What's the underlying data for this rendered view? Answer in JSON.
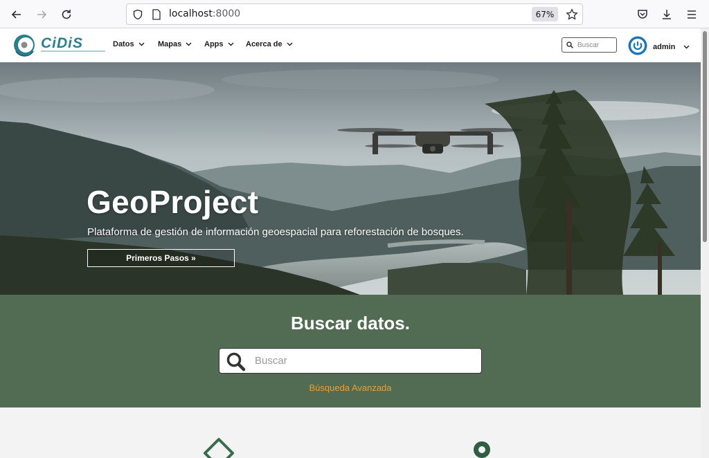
{
  "browser": {
    "url_host": "localhost",
    "url_port": ":8000",
    "zoom": "67%"
  },
  "site": {
    "logo_text": "CiDiS",
    "menu": [
      {
        "label": "Datos"
      },
      {
        "label": "Mapas"
      },
      {
        "label": "Apps"
      },
      {
        "label": "Acerca de"
      }
    ],
    "search_placeholder": "Buscar",
    "user": "admin"
  },
  "hero": {
    "title": "GeoProject",
    "subtitle": "Plataforma de gestión de información geoespacial para reforestación de bosques.",
    "button": "Primeros Pasos »"
  },
  "search_band": {
    "title": "Buscar datos.",
    "placeholder": "Buscar",
    "advanced_link": "Búsqueda Avanzada"
  },
  "colors": {
    "band_bg": "#526b53",
    "link_orange": "#e8a138",
    "logo_teal": "#2a7e8e",
    "user_blue": "#1e77b5"
  }
}
